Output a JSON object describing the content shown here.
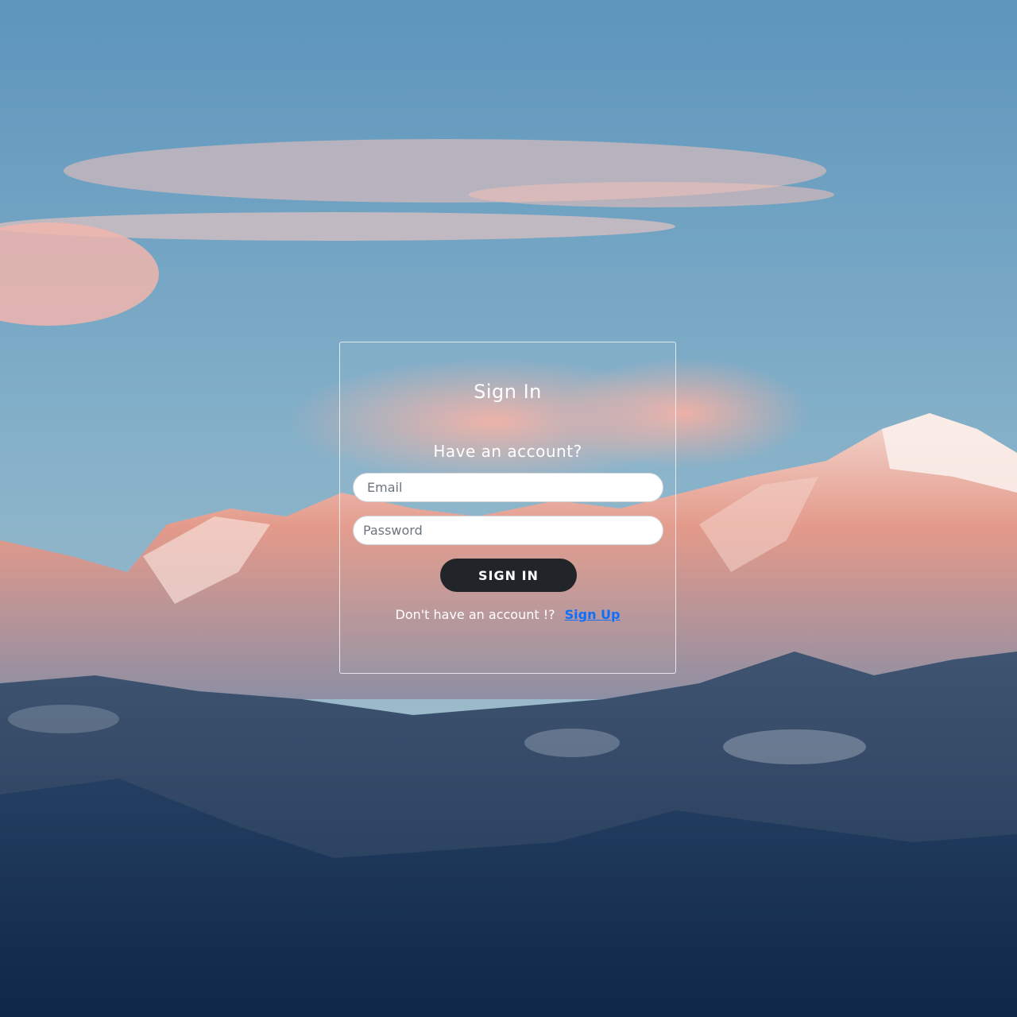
{
  "form": {
    "title": "Sign In",
    "subtitle": "Have an account?",
    "email_placeholder": "Email",
    "password_placeholder": "Password",
    "submit_label": "SIGN IN",
    "signup_prompt": "Don't have an account !?",
    "signup_link": "Sign Up"
  },
  "colors": {
    "button": "#212529",
    "link": "#0d6efd"
  }
}
